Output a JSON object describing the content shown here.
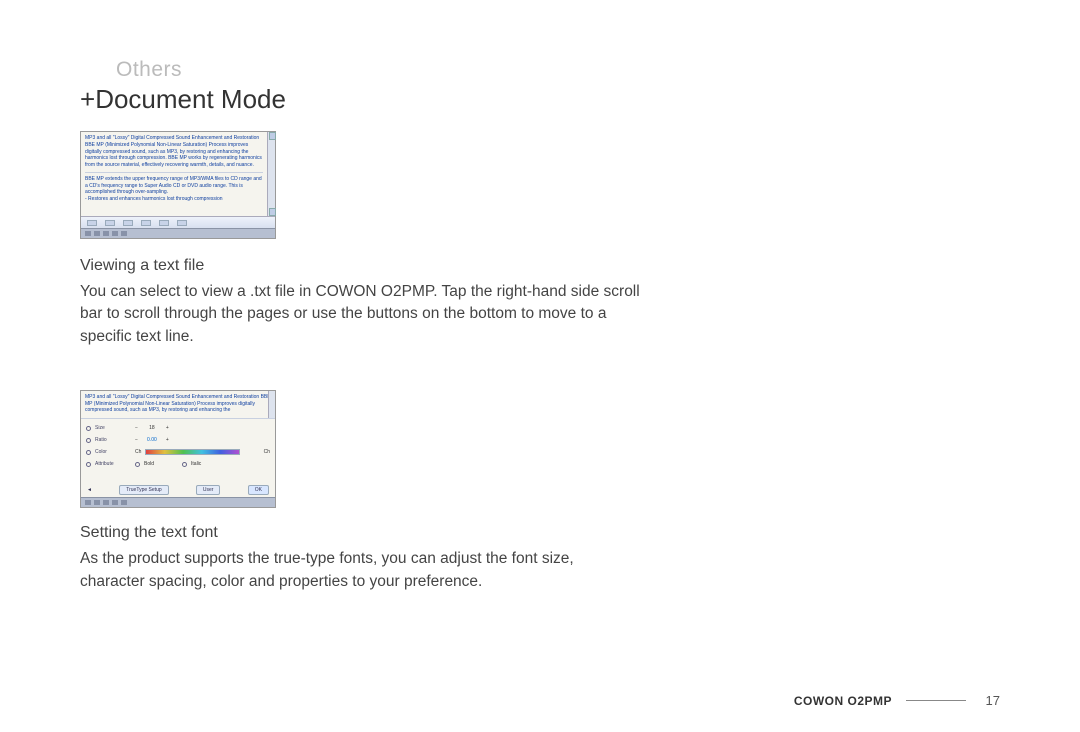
{
  "category": "Others",
  "title_prefix": "+",
  "title": "Document Mode",
  "screenshot1": {
    "para1": "MP3 and all \"Lossy\" Digital Compressed Sound Enhancement and Restoration BBE MP (Minimized Polynomial Non-Linear Saturation) Process improves digitally compressed sound, such as MP3, by restoring and enhancing the harmonics lost through compression. BBE MP works by regenerating harmonics from the source material, effectively recovering warmth, details, and nuance.",
    "para2": "BBE MP extends the upper frequency range of MP3/WMA files to CD range and a CD's frequency range to Super Audio CD or DVD audio range. This is accomplished through over-sampling.",
    "para3": "- Restores and enhances harmonics lost through compression"
  },
  "section1": {
    "heading": "Viewing a text file",
    "body": "You can select to view a .txt file in COWON O2PMP.\nTap the right-hand side scroll bar to scroll through the pages or use the buttons on the bottom to move to a specific text line."
  },
  "screenshot2": {
    "preview": "MP3 and all \"Lossy\" Digital Compressed Sound Enhancement and Restoration BBE MP (Minimized Polynomial Non-Linear Saturation) Process improves digitally compressed sound, such as MP3, by restoring and enhancing the",
    "rows": {
      "size": {
        "label": "Size",
        "minus": "−",
        "value": "18",
        "plus": "+"
      },
      "ratio": {
        "label": "Ratio",
        "minus": "−",
        "value": "0.00",
        "plus": "+"
      },
      "color": {
        "label": "Color",
        "chA": "Ch",
        "chB": "Ch"
      },
      "attr": {
        "label": "Attribute",
        "optA": "Bold",
        "optB": "Italic"
      }
    },
    "btnrow": {
      "left": "TrueType Setup",
      "mid": "User",
      "right": "OK"
    }
  },
  "section2": {
    "heading": "Setting the text font",
    "body": "As the product supports the true-type fonts, you can adjust the font size, character spacing, color and properties to your preference."
  },
  "footer": {
    "brand": "COWON O2PMP",
    "page": "17"
  }
}
